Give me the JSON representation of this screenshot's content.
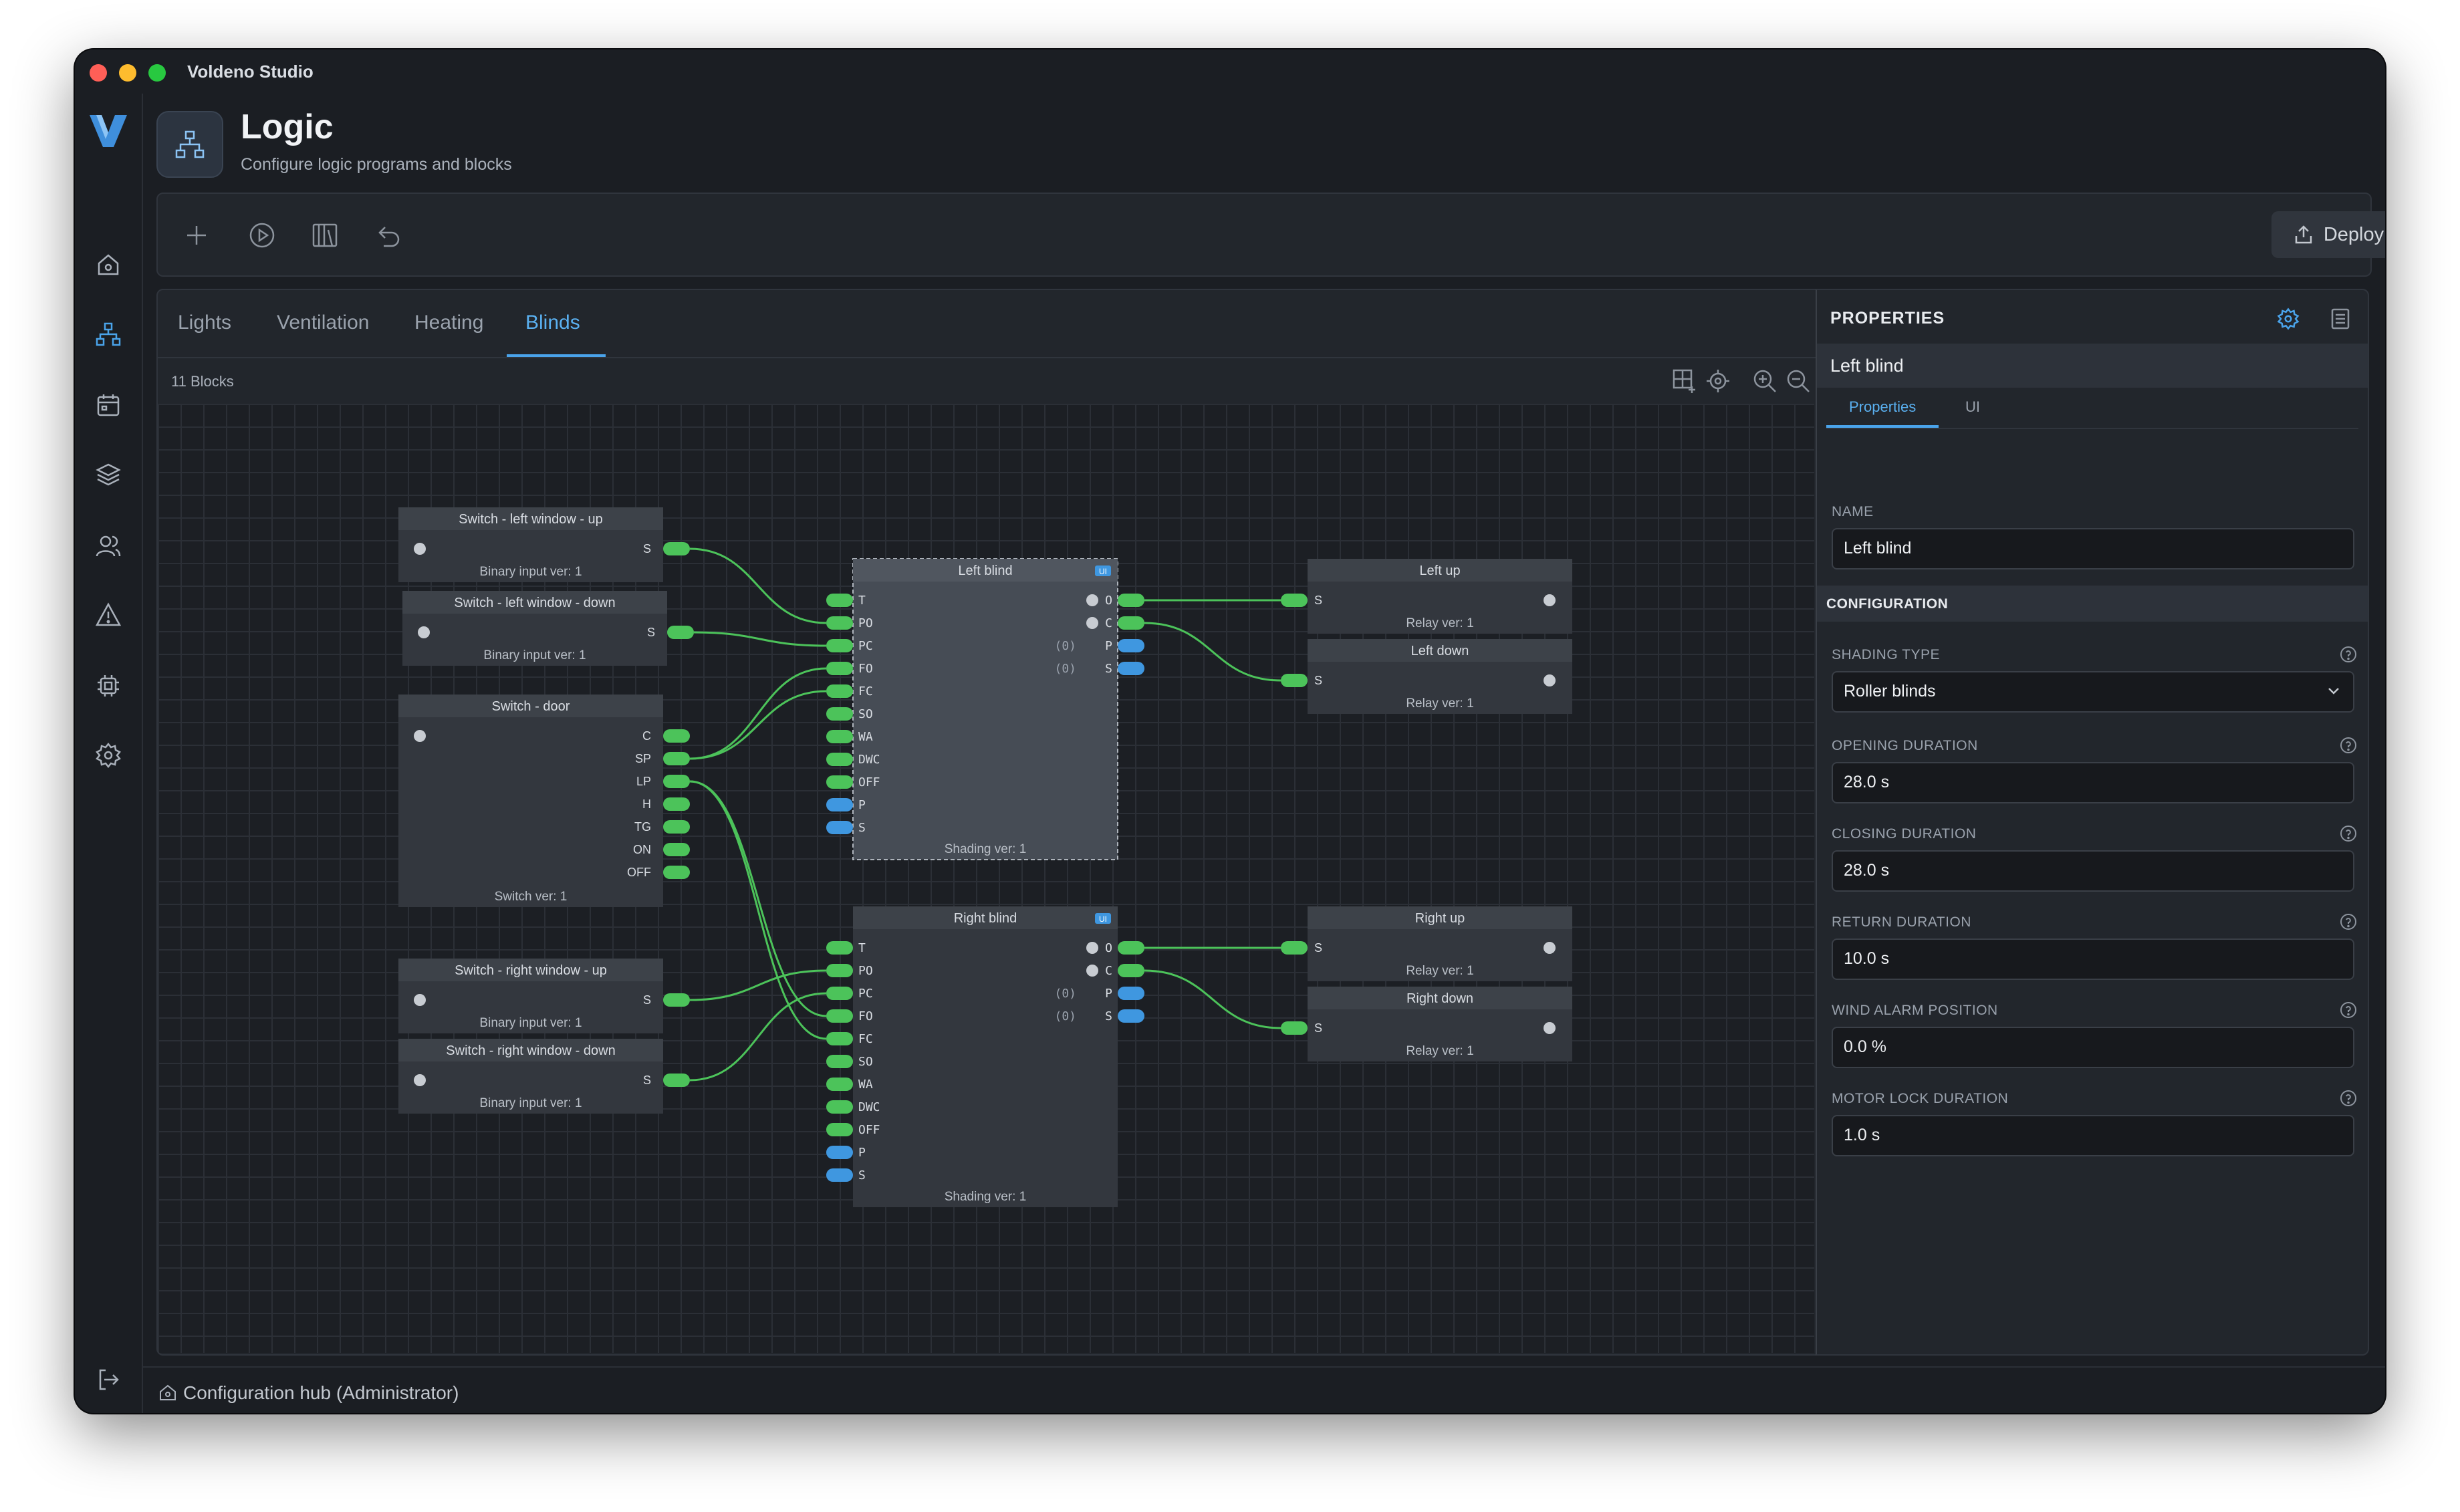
{
  "app": {
    "title": "Voldeno Studio"
  },
  "sidebar": {
    "logo": "voldeno-logo",
    "items": [
      {
        "icon": "home-icon"
      },
      {
        "icon": "logic-icon",
        "active": true
      },
      {
        "icon": "calendar-icon"
      },
      {
        "icon": "layers-icon"
      },
      {
        "icon": "users-icon"
      },
      {
        "icon": "alert-icon"
      },
      {
        "icon": "chip-icon"
      },
      {
        "icon": "settings-icon"
      }
    ],
    "logout_icon": "logout-icon"
  },
  "header": {
    "title": "Logic",
    "subtitle": "Configure logic programs and blocks"
  },
  "toolbar": {
    "deploy_label": "Deploy"
  },
  "tabs": [
    {
      "label": "Lights"
    },
    {
      "label": "Ventilation"
    },
    {
      "label": "Heating"
    },
    {
      "label": "Blinds",
      "active": true
    }
  ],
  "canvas": {
    "blocks_count": "11 Blocks"
  },
  "blocks": {
    "sw_left_up": {
      "title": "Switch - left window - up",
      "footer": "Binary input ver: 1",
      "outputs": [
        "S"
      ]
    },
    "sw_left_down": {
      "title": "Switch - left window - down",
      "footer": "Binary input ver: 1",
      "outputs": [
        "S"
      ]
    },
    "sw_door": {
      "title": "Switch - door",
      "footer": "Switch ver: 1",
      "outputs": [
        "C",
        "SP",
        "LP",
        "H",
        "TG",
        "ON",
        "OFF"
      ]
    },
    "sw_right_up": {
      "title": "Switch - right window - up",
      "footer": "Binary input ver: 1",
      "outputs": [
        "S"
      ]
    },
    "sw_right_down": {
      "title": "Switch - right window - down",
      "footer": "Binary input ver: 1",
      "outputs": [
        "S"
      ]
    },
    "left_blind": {
      "title": "Left blind",
      "badge": "UI",
      "footer": "Shading ver: 1",
      "inputs": [
        "T",
        "PO",
        "PC",
        "FO",
        "FC",
        "SO",
        "WA",
        "DWC",
        "OFF",
        "P",
        "S"
      ],
      "outputs": [
        {
          "label": "O"
        },
        {
          "label": "C"
        },
        {
          "prefix": "(0)",
          "label": "P"
        },
        {
          "prefix": "(0)",
          "label": "S"
        }
      ]
    },
    "right_blind": {
      "title": "Right blind",
      "badge": "UI",
      "footer": "Shading ver: 1",
      "inputs": [
        "T",
        "PO",
        "PC",
        "FO",
        "FC",
        "SO",
        "WA",
        "DWC",
        "OFF",
        "P",
        "S"
      ],
      "outputs": [
        {
          "label": "O"
        },
        {
          "label": "C"
        },
        {
          "prefix": "(0)",
          "label": "P"
        },
        {
          "prefix": "(0)",
          "label": "S"
        }
      ]
    },
    "left_up": {
      "title": "Left up",
      "footer": "Relay ver: 1",
      "inputs": [
        "S"
      ]
    },
    "left_down": {
      "title": "Left down",
      "footer": "Relay ver: 1",
      "inputs": [
        "S"
      ]
    },
    "right_up": {
      "title": "Right up",
      "footer": "Relay ver: 1",
      "inputs": [
        "S"
      ]
    },
    "right_down": {
      "title": "Right down",
      "footer": "Relay ver: 1",
      "inputs": [
        "S"
      ]
    }
  },
  "properties": {
    "title": "PROPERTIES",
    "selected": "Left blind",
    "tabs": [
      {
        "label": "Properties",
        "active": true
      },
      {
        "label": "UI"
      }
    ],
    "name": {
      "label": "NAME",
      "value": "Left blind"
    },
    "section": "CONFIGURATION",
    "fields": [
      {
        "label": "SHADING TYPE",
        "value": "Roller blinds",
        "type": "select"
      },
      {
        "label": "OPENING DURATION",
        "value": "28.0 s"
      },
      {
        "label": "CLOSING DURATION",
        "value": "28.0 s"
      },
      {
        "label": "RETURN DURATION",
        "value": "10.0 s"
      },
      {
        "label": "WIND ALARM POSITION",
        "value": "0.0 %"
      },
      {
        "label": "MOTOR LOCK DURATION",
        "value": "1.0 s"
      }
    ]
  },
  "status": {
    "text": "Configuration hub (Administrator)"
  },
  "colors": {
    "accent": "#4aa3ea",
    "port_binary": "#4cc35a",
    "port_analog": "#3f97e0",
    "wire": "#4cc35a"
  }
}
